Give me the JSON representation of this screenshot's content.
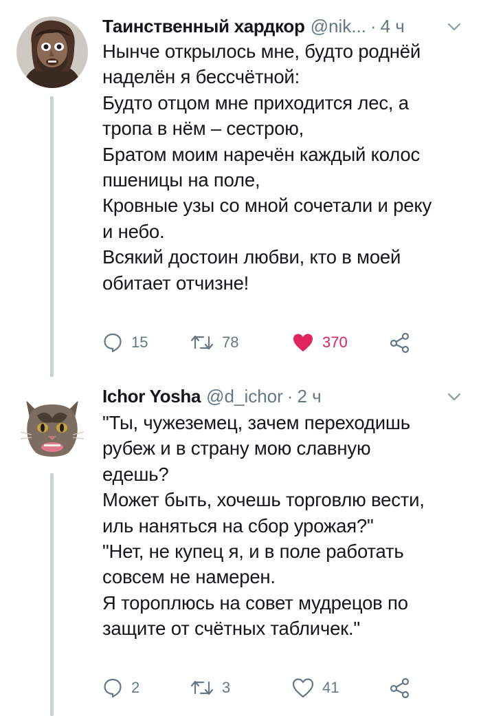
{
  "tweets": [
    {
      "author_name": "Таинственный хардкор",
      "handle": "@nik...",
      "separator": "·",
      "time": "4 ч",
      "avatar_icon": "person-avatar",
      "lines": [
        "Нынче открылось мне, будто роднёй",
        "наделён я бессчётной:",
        "Будто отцом мне приходится лес, а",
        "тропа в нём – сестрою,",
        "Братом моим наречён каждый колос",
        "пшеницы на поле,",
        "Кровные узы со мной сочетали и реку",
        "и небо.",
        "Всякий достоин любви, кто в моей",
        "обитает отчизне!"
      ],
      "replies": "15",
      "retweets": "78",
      "likes": "370",
      "liked": true
    },
    {
      "author_name": "Ichor Yosha",
      "handle": "@d_ichor",
      "separator": "·",
      "time": "2 ч",
      "avatar_icon": "cat-avatar",
      "lines": [
        "\"Ты, чужеземец, зачем переходишь",
        "рубеж и в страну мою славную",
        "едешь?",
        "Может быть, хочешь торговлю вести,",
        "иль наняться на сбор урожая?\"",
        "\"Нет, не купец я, и в поле работать",
        "совсем не намерен.",
        "Я тороплюсь на совет мудрецов по",
        "защите от счётных табличек.\""
      ],
      "replies": "2",
      "retweets": "3",
      "likes": "41",
      "liked": false
    }
  ],
  "colors": {
    "text": "#14171a",
    "secondary": "#657786",
    "like": "#e0245e",
    "thread_line": "#c5d1db"
  }
}
